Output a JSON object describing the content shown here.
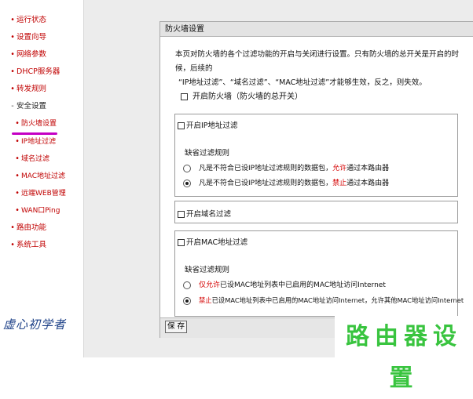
{
  "sidebar": {
    "items": [
      {
        "label": "运行状态"
      },
      {
        "label": "设置向导"
      },
      {
        "label": "网络参数"
      },
      {
        "label": "DHCP服务器"
      },
      {
        "label": "转发规则"
      },
      {
        "label": "安全设置"
      },
      {
        "label": "防火墙设置"
      },
      {
        "label": "IP地址过滤"
      },
      {
        "label": "域名过滤"
      },
      {
        "label": "MAC地址过滤"
      },
      {
        "label": "远端WEB管理"
      },
      {
        "label": "WAN口Ping"
      },
      {
        "label": "路由功能"
      },
      {
        "label": "系统工具"
      }
    ],
    "signature": "虚心初学者"
  },
  "panel": {
    "title": "防火墙设置",
    "description_line1": "本页对防火墙的各个过滤功能的开启与关闭进行设置。只有防火墙的总开关是开启的时候，后续的",
    "description_line2": "“IP地址过滤”、“域名过滤”、“MAC地址过滤”才能够生效，反之，则失效。",
    "master_toggle_label": "开启防火墙（防火墙的总开关）",
    "ip_filter": {
      "title": "开启IP地址过滤",
      "default_rule_label": "缺省过滤规则",
      "option1_prefix": "凡是不符合已设IP地址过滤规则的数据包，",
      "option1_emph": "允许",
      "option1_suffix": "通过本路由器",
      "option2_prefix": "凡是不符合已设IP地址过滤规则的数据包，",
      "option2_emph": "禁止",
      "option2_suffix": "通过本路由器",
      "selected": 2
    },
    "domain_filter": {
      "title": "开启域名过滤"
    },
    "mac_filter": {
      "title": "开启MAC地址过滤",
      "default_rule_label": "缺省过滤规则",
      "option1_emph": "仅允许",
      "option1_suffix": "已设MAC地址列表中已启用的MAC地址访问Internet",
      "option2_emph": "禁止",
      "option2_suffix": "已设MAC地址列表中已启用的MAC地址访问Internet，允许其他MAC地址访问Internet",
      "selected": 2
    },
    "save_label": "保 存"
  },
  "watermark": "路由器设置"
}
